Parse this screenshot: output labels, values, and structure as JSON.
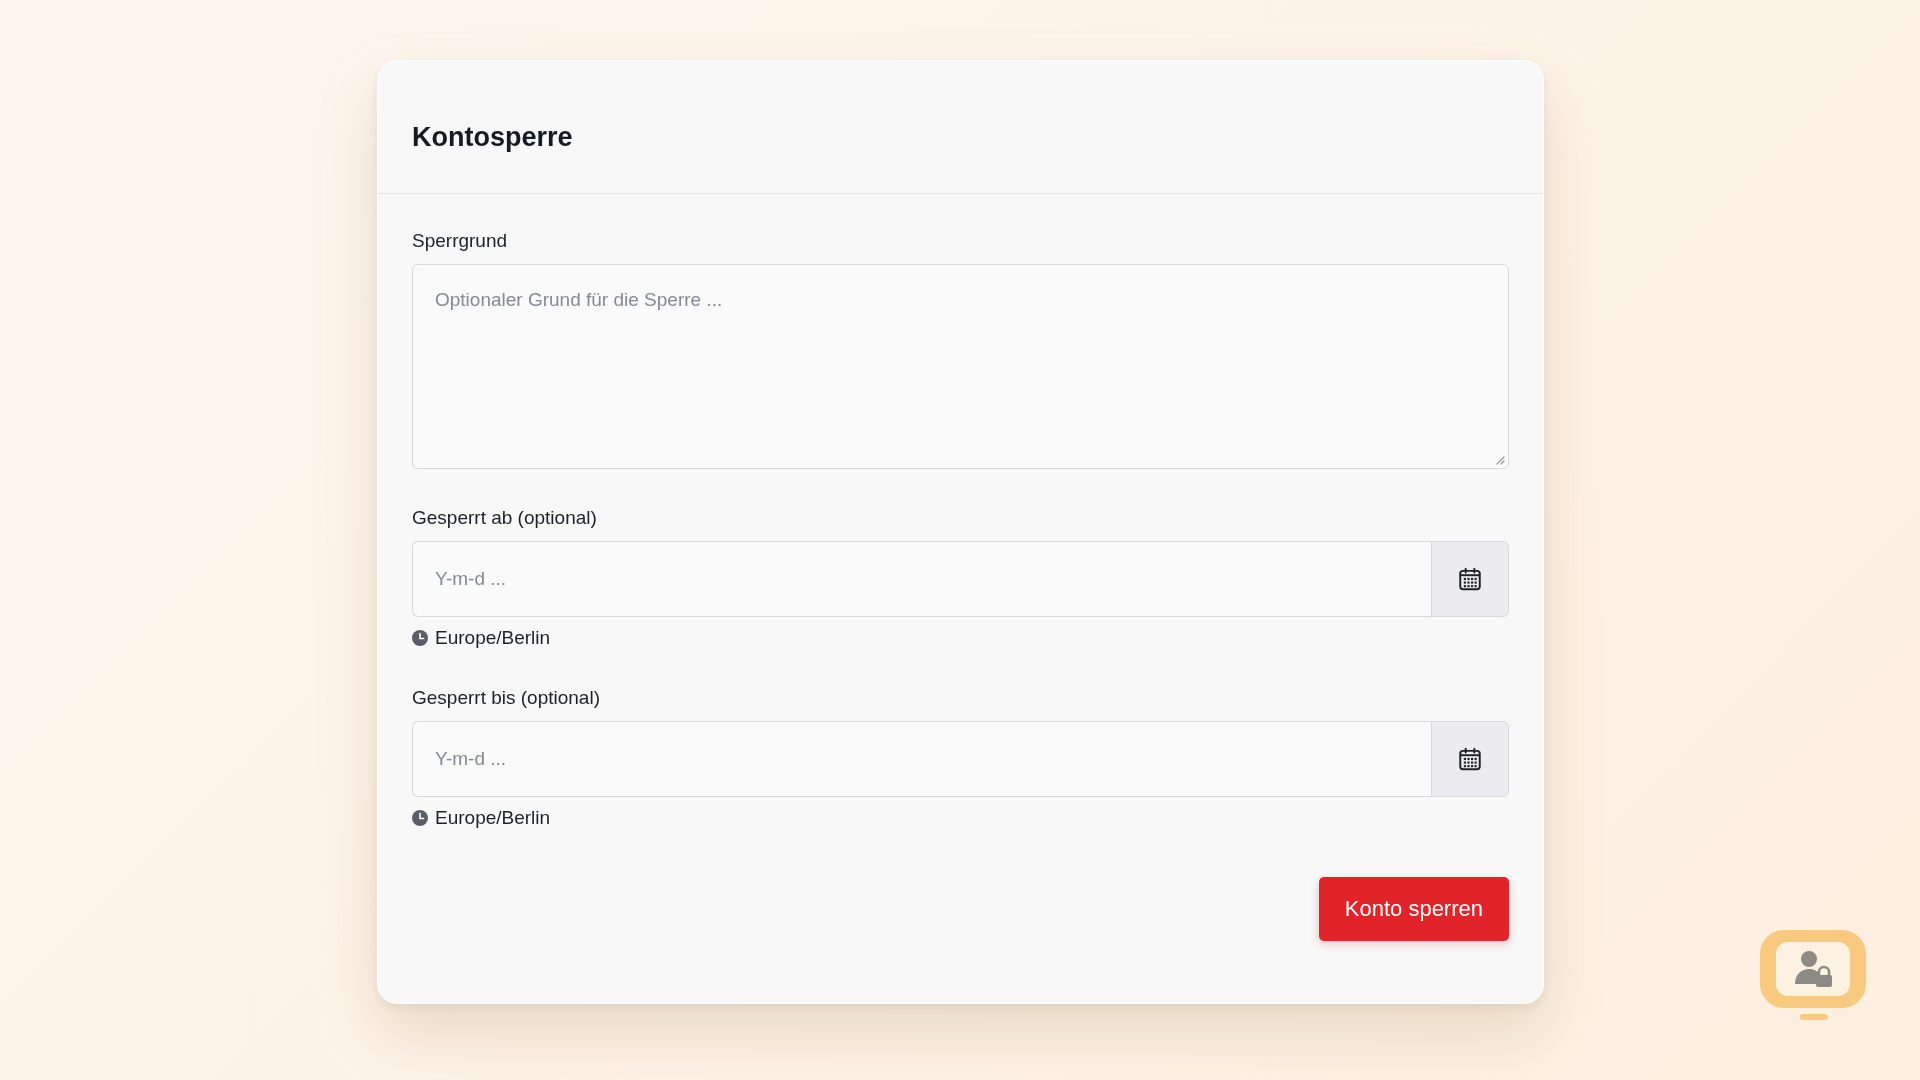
{
  "card": {
    "title": "Kontosperre"
  },
  "fields": [
    {
      "kind": "textarea",
      "label": "Sperrgrund",
      "placeholder": "Optionaler Grund für die Sperre ..."
    },
    {
      "kind": "date",
      "label": "Gesperrt ab (optional)",
      "placeholder": "Y-m-d ...",
      "timezone": "Europe/Berlin"
    },
    {
      "kind": "date",
      "label": "Gesperrt bis (optional)",
      "placeholder": "Y-m-d ...",
      "timezone": "Europe/Berlin"
    }
  ],
  "submit_button": {
    "label": "Konto sperren"
  }
}
